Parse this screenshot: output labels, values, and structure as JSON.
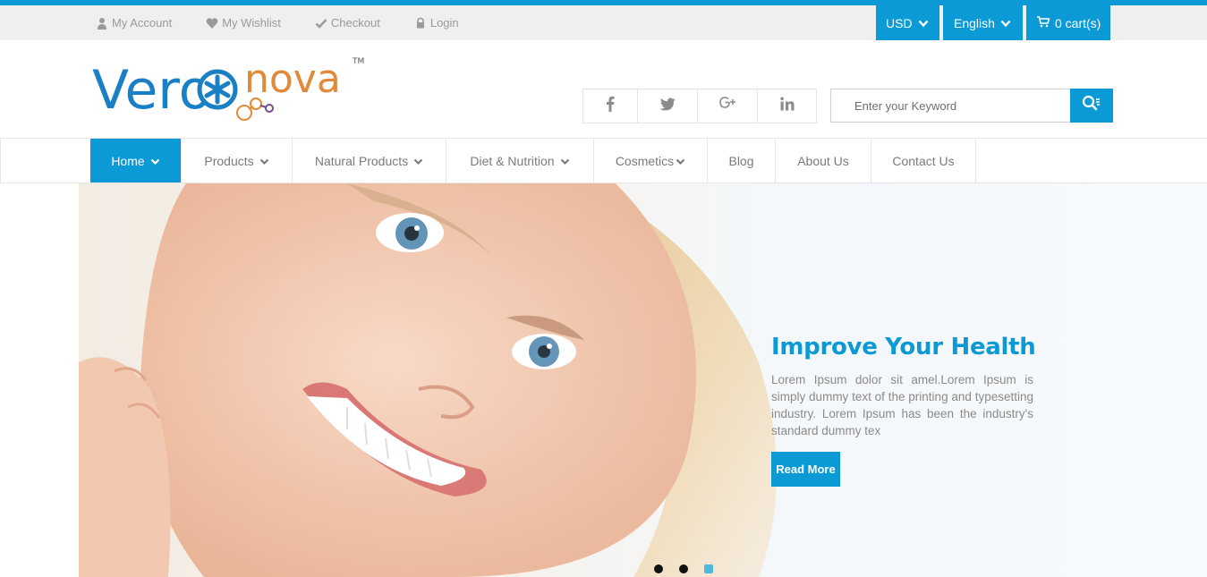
{
  "colors": {
    "accent": "#0b9ad6",
    "topbar_bg": "#efefef"
  },
  "topbar": {
    "links": [
      {
        "icon": "user-icon",
        "label": "My Account"
      },
      {
        "icon": "heart-icon",
        "label": "My Wishlist"
      },
      {
        "icon": "check-icon",
        "label": "Checkout"
      },
      {
        "icon": "lock-icon",
        "label": "Login"
      }
    ],
    "currency": "USD",
    "language": "English",
    "cart": "0 cart(s)"
  },
  "logo": {
    "part1": "Vero",
    "part2": "nova",
    "tm": "TM"
  },
  "social": [
    "facebook-icon",
    "twitter-icon",
    "google-plus-icon",
    "linkedin-icon"
  ],
  "search": {
    "placeholder": "Enter your Keyword"
  },
  "nav": {
    "items": [
      {
        "label": "Home",
        "dropdown": true,
        "active": true
      },
      {
        "label": "Products",
        "dropdown": true
      },
      {
        "label": "Natural Products",
        "dropdown": true
      },
      {
        "label": "Diet & Nutrition",
        "dropdown": true
      },
      {
        "label": "Cosmetics",
        "dropdown": true
      },
      {
        "label": "Blog",
        "dropdown": false
      },
      {
        "label": "About Us",
        "dropdown": false
      },
      {
        "label": "Contact Us",
        "dropdown": false
      }
    ]
  },
  "slider": {
    "title": "Improve Your Health",
    "text": "Lorem Ipsum dolor sit amel.Lorem Ipsum is simply dummy text of the printing and typesetting industry. Lorem Ipsum has been the industry's standard dummy tex",
    "button": "Read More",
    "slides": 3,
    "active_slide": 3
  }
}
